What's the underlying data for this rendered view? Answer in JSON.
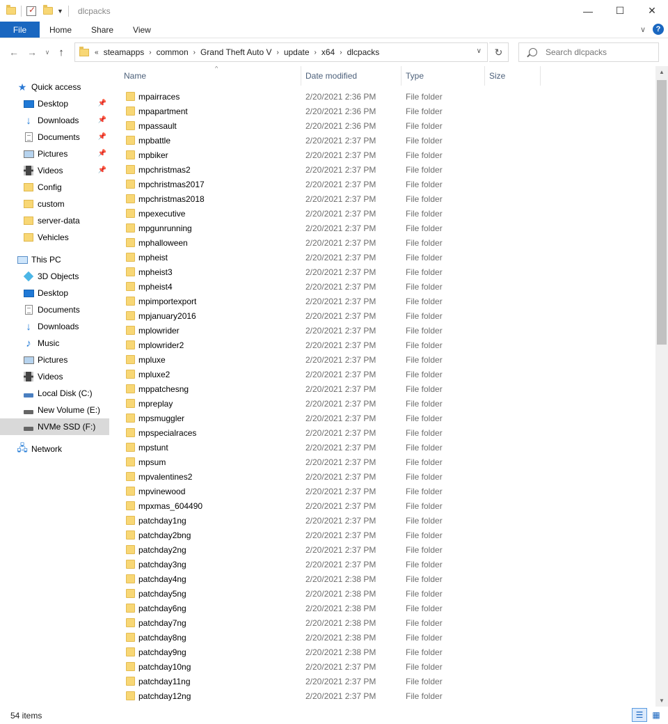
{
  "window": {
    "title": "dlcpacks"
  },
  "ribbon": {
    "tabs": [
      "File",
      "Home",
      "Share",
      "View"
    ]
  },
  "address": {
    "crumbs": [
      "steamapps",
      "common",
      "Grand Theft Auto V",
      "update",
      "x64",
      "dlcpacks"
    ]
  },
  "search": {
    "placeholder": "Search dlcpacks"
  },
  "sidebar": {
    "quick_access": "Quick access",
    "quick_items": [
      "Desktop",
      "Downloads",
      "Documents",
      "Pictures",
      "Videos",
      "Config",
      "custom",
      "server-data",
      "Vehicles"
    ],
    "this_pc": "This PC",
    "pc_items": [
      "3D Objects",
      "Desktop",
      "Documents",
      "Downloads",
      "Music",
      "Pictures",
      "Videos",
      "Local Disk (C:)",
      "New Volume (E:)",
      "NVMe SSD (F:)"
    ],
    "network": "Network"
  },
  "columns": {
    "name": "Name",
    "date": "Date modified",
    "type": "Type",
    "size": "Size"
  },
  "files": [
    [
      "mpairraces",
      "2/20/2021 2:36 PM",
      "File folder"
    ],
    [
      "mpapartment",
      "2/20/2021 2:36 PM",
      "File folder"
    ],
    [
      "mpassault",
      "2/20/2021 2:36 PM",
      "File folder"
    ],
    [
      "mpbattle",
      "2/20/2021 2:37 PM",
      "File folder"
    ],
    [
      "mpbiker",
      "2/20/2021 2:37 PM",
      "File folder"
    ],
    [
      "mpchristmas2",
      "2/20/2021 2:37 PM",
      "File folder"
    ],
    [
      "mpchristmas2017",
      "2/20/2021 2:37 PM",
      "File folder"
    ],
    [
      "mpchristmas2018",
      "2/20/2021 2:37 PM",
      "File folder"
    ],
    [
      "mpexecutive",
      "2/20/2021 2:37 PM",
      "File folder"
    ],
    [
      "mpgunrunning",
      "2/20/2021 2:37 PM",
      "File folder"
    ],
    [
      "mphalloween",
      "2/20/2021 2:37 PM",
      "File folder"
    ],
    [
      "mpheist",
      "2/20/2021 2:37 PM",
      "File folder"
    ],
    [
      "mpheist3",
      "2/20/2021 2:37 PM",
      "File folder"
    ],
    [
      "mpheist4",
      "2/20/2021 2:37 PM",
      "File folder"
    ],
    [
      "mpimportexport",
      "2/20/2021 2:37 PM",
      "File folder"
    ],
    [
      "mpjanuary2016",
      "2/20/2021 2:37 PM",
      "File folder"
    ],
    [
      "mplowrider",
      "2/20/2021 2:37 PM",
      "File folder"
    ],
    [
      "mplowrider2",
      "2/20/2021 2:37 PM",
      "File folder"
    ],
    [
      "mpluxe",
      "2/20/2021 2:37 PM",
      "File folder"
    ],
    [
      "mpluxe2",
      "2/20/2021 2:37 PM",
      "File folder"
    ],
    [
      "mppatchesng",
      "2/20/2021 2:37 PM",
      "File folder"
    ],
    [
      "mpreplay",
      "2/20/2021 2:37 PM",
      "File folder"
    ],
    [
      "mpsmuggler",
      "2/20/2021 2:37 PM",
      "File folder"
    ],
    [
      "mpspecialraces",
      "2/20/2021 2:37 PM",
      "File folder"
    ],
    [
      "mpstunt",
      "2/20/2021 2:37 PM",
      "File folder"
    ],
    [
      "mpsum",
      "2/20/2021 2:37 PM",
      "File folder"
    ],
    [
      "mpvalentines2",
      "2/20/2021 2:37 PM",
      "File folder"
    ],
    [
      "mpvinewood",
      "2/20/2021 2:37 PM",
      "File folder"
    ],
    [
      "mpxmas_604490",
      "2/20/2021 2:37 PM",
      "File folder"
    ],
    [
      "patchday1ng",
      "2/20/2021 2:37 PM",
      "File folder"
    ],
    [
      "patchday2bng",
      "2/20/2021 2:37 PM",
      "File folder"
    ],
    [
      "patchday2ng",
      "2/20/2021 2:37 PM",
      "File folder"
    ],
    [
      "patchday3ng",
      "2/20/2021 2:37 PM",
      "File folder"
    ],
    [
      "patchday4ng",
      "2/20/2021 2:38 PM",
      "File folder"
    ],
    [
      "patchday5ng",
      "2/20/2021 2:38 PM",
      "File folder"
    ],
    [
      "patchday6ng",
      "2/20/2021 2:38 PM",
      "File folder"
    ],
    [
      "patchday7ng",
      "2/20/2021 2:38 PM",
      "File folder"
    ],
    [
      "patchday8ng",
      "2/20/2021 2:38 PM",
      "File folder"
    ],
    [
      "patchday9ng",
      "2/20/2021 2:38 PM",
      "File folder"
    ],
    [
      "patchday10ng",
      "2/20/2021 2:37 PM",
      "File folder"
    ],
    [
      "patchday11ng",
      "2/20/2021 2:37 PM",
      "File folder"
    ],
    [
      "patchday12ng",
      "2/20/2021 2:37 PM",
      "File folder"
    ]
  ],
  "status": {
    "item_count": "54 items"
  },
  "colors": {
    "accent": "#1a67c0",
    "folder": "#f8d775",
    "selected": "#d9d9d9"
  }
}
